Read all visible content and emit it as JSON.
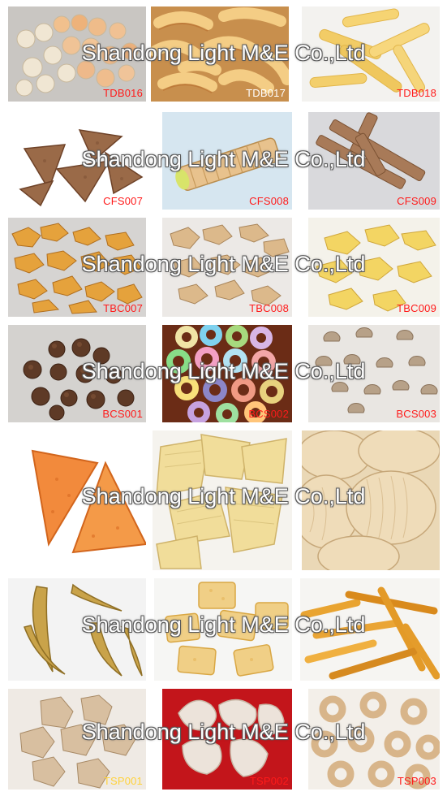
{
  "watermark": "Shandong Light M&E Co.,Ltd",
  "rows": [
    {
      "items": [
        {
          "code": "TDB016",
          "desc": "puffed balls"
        },
        {
          "code": "TDB017",
          "desc": "puffed curls"
        },
        {
          "code": "TDB018",
          "desc": "corn sticks"
        }
      ]
    },
    {
      "items": [
        {
          "code": "CFS007",
          "desc": "triangle chips"
        },
        {
          "code": "CFS008",
          "desc": "filled pillow roll"
        },
        {
          "code": "CFS009",
          "desc": "crispy sticks"
        }
      ]
    },
    {
      "items": [
        {
          "code": "TBC007",
          "desc": "corn flakes"
        },
        {
          "code": "TBC008",
          "desc": "cereal flakes"
        },
        {
          "code": "TBC009",
          "desc": "yellow corn flakes"
        }
      ]
    },
    {
      "items": [
        {
          "code": "BCS001",
          "desc": "chocolate cereal balls"
        },
        {
          "code": "BCS002",
          "desc": "colored cereal rings"
        },
        {
          "code": "BCS003",
          "desc": "cereal shells"
        }
      ]
    },
    {
      "items": [
        {
          "code": "",
          "desc": "doritos triangles"
        },
        {
          "code": "",
          "desc": "pellet chips"
        },
        {
          "code": "",
          "desc": "wavy potato chips"
        }
      ]
    },
    {
      "items": [
        {
          "code": "",
          "desc": "banana shaped snacks"
        },
        {
          "code": "",
          "desc": "square crackers"
        },
        {
          "code": "",
          "desc": "fried sticks"
        }
      ]
    },
    {
      "items": [
        {
          "code": "TSP001",
          "desc": "textured soy protein"
        },
        {
          "code": "TSP002",
          "desc": "soy protein chunks"
        },
        {
          "code": "TSP003",
          "desc": "soy protein rings"
        }
      ]
    }
  ]
}
